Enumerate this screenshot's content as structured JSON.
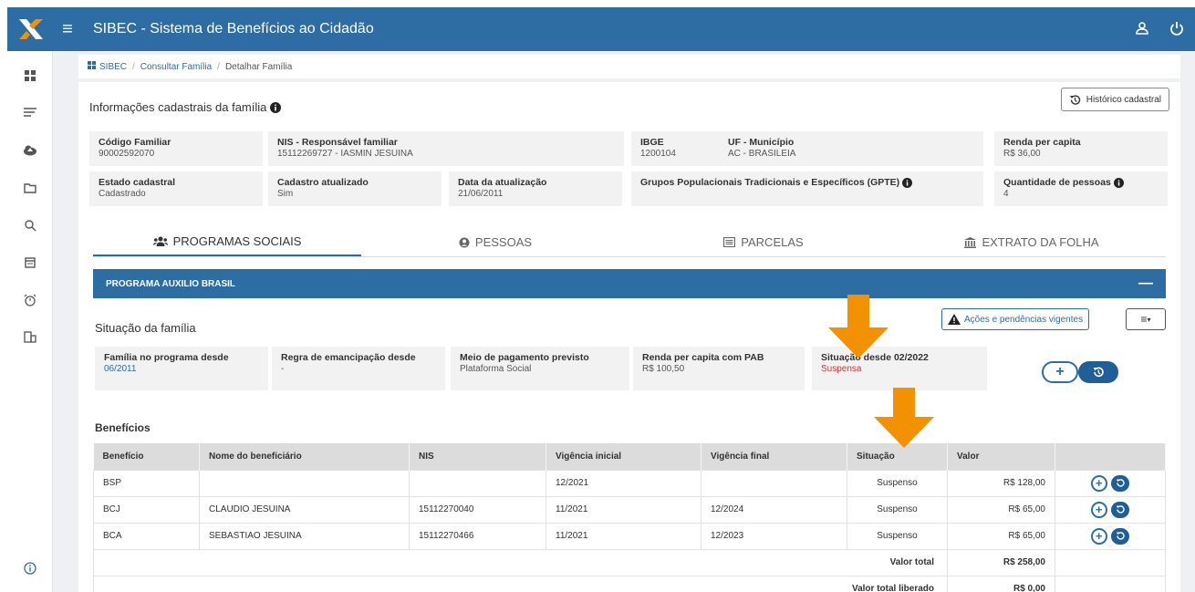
{
  "app": {
    "title": "SIBEC - Sistema de Benefícios ao Cidadão"
  },
  "breadcrumb": {
    "home": "SIBEC",
    "level1": "Consultar Família",
    "current": "Detalhar Família"
  },
  "family_info": {
    "title": "Informações cadastrais da família",
    "history_button": "Histórico cadastral",
    "fields": {
      "codigo_label": "Código Familiar",
      "codigo_value": "90002592070",
      "nis_label": "NIS - Responsável familiar",
      "nis_value": "15112269727 - IASMIN JESUINA",
      "ibge_label": "IBGE",
      "ibge_value": "1200104",
      "uf_label": "UF - Município",
      "uf_value": "AC - BRASILEIA",
      "renda_label": "Renda per capita",
      "renda_value": "R$ 36,00",
      "estado_label": "Estado cadastral",
      "estado_value": "Cadastrado",
      "atualizado_label": "Cadastro atualizado",
      "atualizado_value": "Sim",
      "data_label": "Data da atualização",
      "data_value": "21/06/2011",
      "gpte_label": "Grupos Populacionais Tradicionais e Específicos (GPTE)",
      "qtd_label": "Quantidade de pessoas",
      "qtd_value": "4"
    }
  },
  "tabs": [
    {
      "label": "PROGRAMAS SOCIAIS",
      "active": true
    },
    {
      "label": "PESSOAS",
      "active": false
    },
    {
      "label": "PARCELAS",
      "active": false
    },
    {
      "label": "EXTRATO DA FOLHA",
      "active": false
    }
  ],
  "program": {
    "title": "PROGRAMA AUXILIO BRASIL",
    "collapse_symbol": "—",
    "situation_title": "Situação da família",
    "acoes_button": "Ações e pendências vigentes",
    "fields": {
      "desde_label": "Família no programa desde",
      "desde_value": "06/2011",
      "regra_label": "Regra de emancipação desde",
      "regra_value": "-",
      "meio_label": "Meio de pagamento previsto",
      "meio_value": "Plataforma Social",
      "renda_pab_label": "Renda per capita com PAB",
      "renda_pab_value": "R$ 100,50",
      "situacao_label": "Situação desde 02/2022",
      "situacao_value": "Suspensa"
    }
  },
  "benefits": {
    "title": "Benefícios",
    "columns": [
      "Benefício",
      "Nome do beneficiário",
      "NIS",
      "Vigência inicial",
      "Vigência final",
      "Situação",
      "Valor"
    ],
    "rows": [
      {
        "beneficio": "BSP",
        "nome": "",
        "nis": "",
        "inicio": "12/2021",
        "fim": "",
        "situacao": "Suspenso",
        "valor": "R$ 128,00"
      },
      {
        "beneficio": "BCJ",
        "nome": "CLAUDIO JESUINA",
        "nis": "15112270040",
        "inicio": "11/2021",
        "fim": "12/2024",
        "situacao": "Suspenso",
        "valor": "R$ 65,00"
      },
      {
        "beneficio": "BCA",
        "nome": "SEBASTIAO JESUINA",
        "nis": "15112270466",
        "inicio": "11/2021",
        "fim": "12/2023",
        "situacao": "Suspenso",
        "valor": "R$ 65,00"
      }
    ],
    "total_label": "Valor total",
    "total_value": "R$ 258,00",
    "liberado_label": "Valor total liberado",
    "liberado_value": "R$ 0,00"
  },
  "colors": {
    "primary": "#2d6da3",
    "dark_blue": "#1f5e96",
    "status_red": "#e03030",
    "arrow_orange": "#f39200",
    "logo_orange": "#f39200"
  },
  "icons": [
    "menu-icon",
    "user-icon",
    "power-icon",
    "dashboard-icon",
    "list-icon",
    "cloud-upload-icon",
    "folder-icon",
    "search-icon",
    "calendar-icon",
    "alarm-icon",
    "building-icon",
    "info-icon",
    "history-icon",
    "warning-icon",
    "users-icon",
    "person-icon",
    "list-alt-icon",
    "bank-icon",
    "plus-icon"
  ]
}
